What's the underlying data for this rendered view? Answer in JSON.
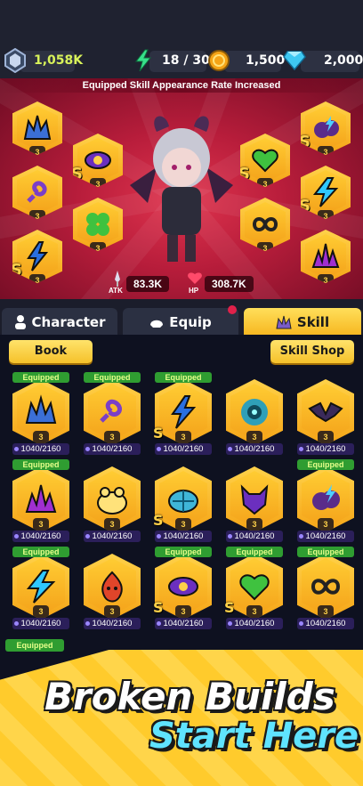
{
  "resources": {
    "gems_amount": "1,058K",
    "energy": "18 / 30",
    "coins": "1,500",
    "diamonds": "2,000"
  },
  "hero": {
    "banner": "Equipped Skill Appearance Rate Increased",
    "atk_label": "ATK",
    "atk_value": "83.3K",
    "hp_label": "HP",
    "hp_value": "308.7K",
    "level_badge": "3",
    "s_badge": "S",
    "skills": [
      {
        "icon": "crown-spikes-icon"
      },
      {
        "icon": "eye-icon"
      },
      {
        "icon": "chain-icon"
      },
      {
        "icon": "clover-icon"
      },
      {
        "icon": "lightning-claw-icon"
      },
      {
        "icon": "storm-cloud-icon"
      },
      {
        "icon": "heart-icon"
      },
      {
        "icon": "lightning-icon"
      },
      {
        "icon": "infinity-icon"
      },
      {
        "icon": "spike-burst-icon"
      }
    ]
  },
  "tabs": {
    "character": "Character",
    "equip": "Equip",
    "skill": "Skill"
  },
  "panel": {
    "book_label": "Book",
    "shop_label": "Skill Shop",
    "equipped_label": "Equipped",
    "progress": "1040/2160",
    "cards": [
      {
        "icon": "crown-spikes-icon",
        "equipped": true
      },
      {
        "icon": "chain-icon",
        "equipped": true
      },
      {
        "icon": "lightning-claw-icon",
        "equipped": true,
        "s": true
      },
      {
        "icon": "vortex-icon",
        "equipped": false
      },
      {
        "icon": "bat-wings-icon",
        "equipped": false
      },
      {
        "icon": "spike-burst-icon",
        "equipped": true
      },
      {
        "icon": "frog-icon",
        "equipped": false
      },
      {
        "icon": "shell-icon",
        "equipped": false,
        "s": true
      },
      {
        "icon": "demon-mask-icon",
        "equipped": false
      },
      {
        "icon": "storm-cloud-icon",
        "equipped": true
      },
      {
        "icon": "lightning-icon",
        "equipped": true
      },
      {
        "icon": "fire-spirit-icon",
        "equipped": false
      },
      {
        "icon": "eye-icon",
        "equipped": true,
        "s": true
      },
      {
        "icon": "heart-icon",
        "equipped": true,
        "s": true
      },
      {
        "icon": "infinity-icon",
        "equipped": true
      }
    ]
  },
  "promo": {
    "line1": "Broken Builds",
    "line2": "Start Here"
  },
  "colors": {
    "gold": "#ffcc33",
    "equipped_green": "#2f9d31",
    "hero_red": "#c8223f",
    "promo_cyan": "#5fe3ff"
  }
}
